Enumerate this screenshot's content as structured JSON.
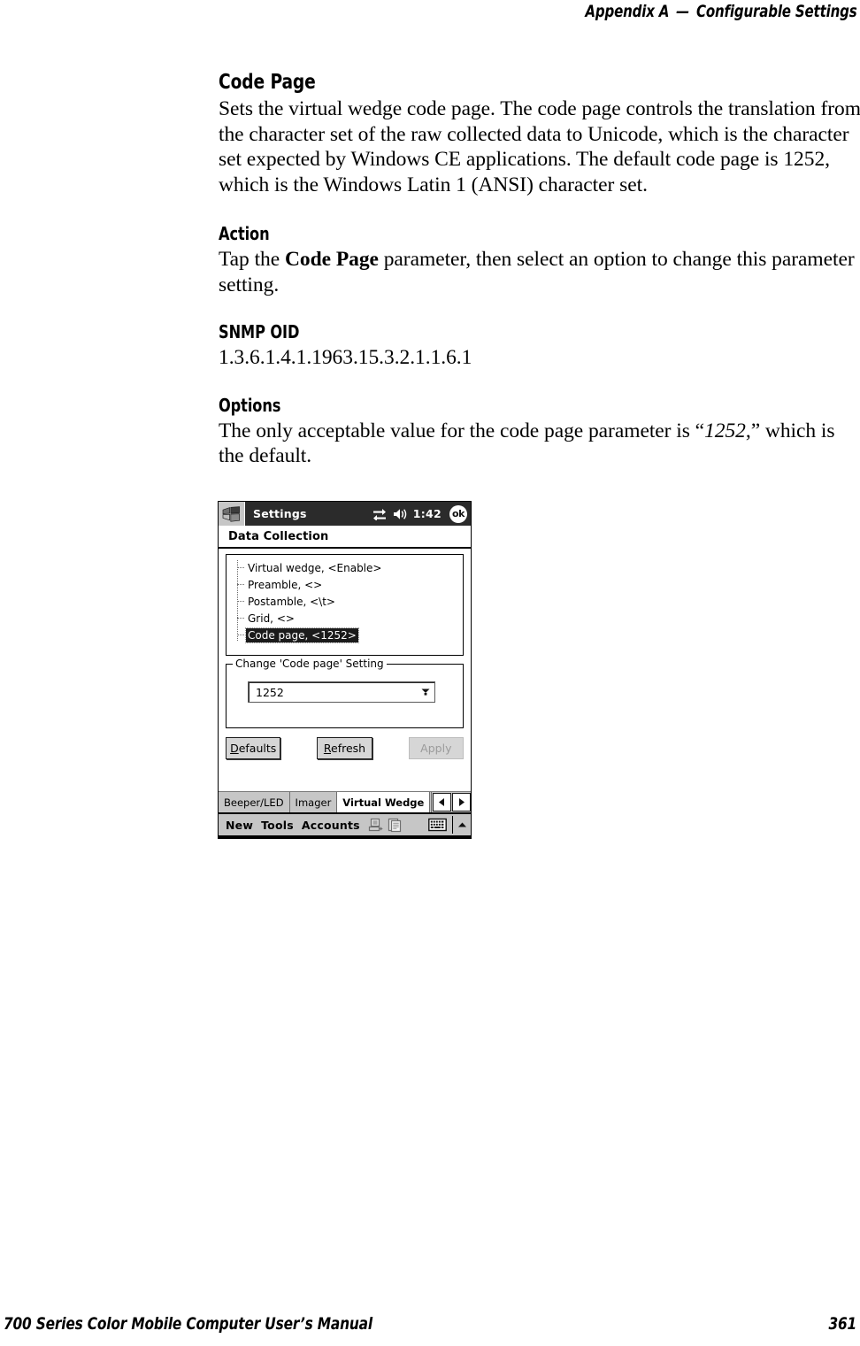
{
  "running_head": {
    "appendix": "Appendix A",
    "separator": "—",
    "title": "Configurable Settings"
  },
  "content": {
    "code_page": {
      "heading": "Code Page",
      "body": "Sets the virtual wedge code page. The code page controls the translation from the character set of the raw collected data to Unicode, which is the character set expected by Windows CE applications. The default code page is 1252, which is the Windows Latin 1 (ANSI) character set."
    },
    "action": {
      "heading": "Action",
      "text_before": "Tap the ",
      "emphasis": "Code Page",
      "text_after": " parameter, then select an option to change this parameter setting."
    },
    "snmp_oid": {
      "heading": "SNMP OID",
      "value": "1.3.6.1.4.1.1963.15.3.2.1.1.6.1"
    },
    "options": {
      "heading": "Options",
      "text_before": "The only acceptable value for the code page parameter is “",
      "emphasis": "1252",
      "text_after": ",” which is the default."
    }
  },
  "pda": {
    "titlebar": {
      "logo": "windows-flag-icon",
      "title": "Settings",
      "connectivity_icon": "connectivity-arrows-icon",
      "volume_icon": "speaker-icon",
      "time": "1:42",
      "ok_label": "ok"
    },
    "page_heading": "Data Collection",
    "tree": {
      "items": [
        {
          "label": "Virtual wedge, <Enable>",
          "selected": false
        },
        {
          "label": "Preamble, <>",
          "selected": false
        },
        {
          "label": "Postamble, <\\t>",
          "selected": false
        },
        {
          "label": "Grid, <>",
          "selected": false
        },
        {
          "label": "Code page, <1252>",
          "selected": true
        }
      ]
    },
    "group": {
      "legend": "Change 'Code page' Setting",
      "combo_value": "1252",
      "combo_arrow_icon": "chevron-down-icon"
    },
    "buttons": {
      "defaults": {
        "accel": "D",
        "rest": "efaults",
        "enabled": true
      },
      "refresh": {
        "accel": "R",
        "rest": "efresh",
        "enabled": true
      },
      "apply": {
        "label": "Apply",
        "enabled": false
      }
    },
    "tabs": [
      {
        "label": "Beeper/LED",
        "active": false
      },
      {
        "label": "Imager",
        "active": false
      },
      {
        "label": "Virtual Wedge",
        "active": true
      }
    ],
    "tab_nav": {
      "prev_icon": "left-arrow-icon",
      "next_icon": "right-arrow-icon"
    },
    "taskbar": {
      "menus": [
        "New",
        "Tools",
        "Accounts"
      ],
      "icons": [
        "connect-desktop-icon",
        "documents-icon"
      ],
      "keyboard_icon": "keyboard-icon",
      "up_arrow_icon": "chevron-up-icon"
    }
  },
  "footer": {
    "title": "700 Series Color Mobile Computer User’s Manual",
    "page": "361"
  },
  "colors": {
    "titlebar_bg": "#2b2b2b",
    "chrome_gray": "#c6c6c6",
    "selection_bg": "#1b1b1b",
    "disabled_text": "#9b9b9b"
  }
}
